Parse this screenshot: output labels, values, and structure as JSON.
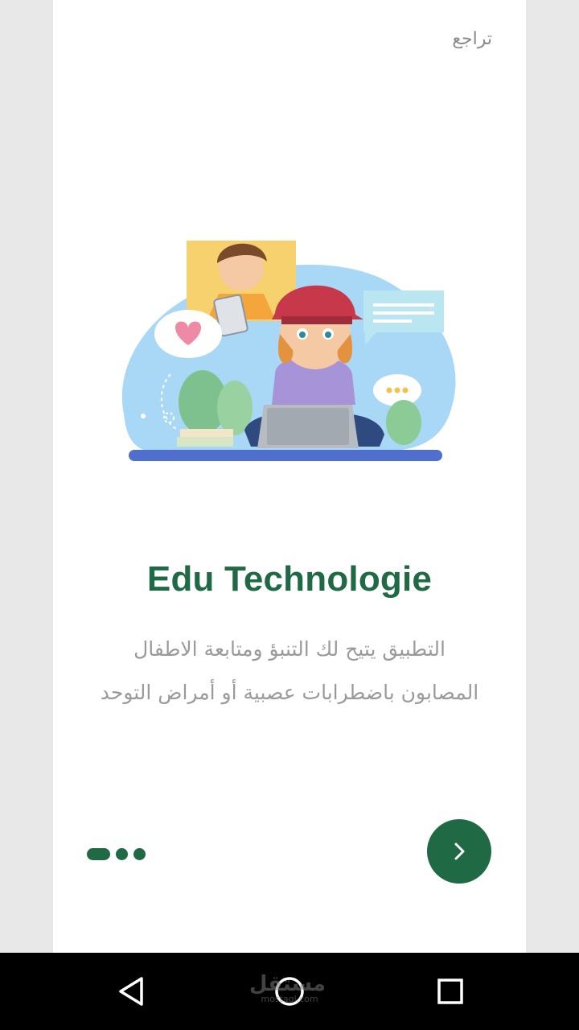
{
  "onboarding": {
    "skip_label": "تراجع",
    "title": "Edu Technologie",
    "description": "التطبيق يتيح لك التنبؤ ومتابعة الاطفال المصابون باضطرابات عصبية أو أمراض التوحد",
    "pager": {
      "total": 3,
      "active_index": 0
    }
  },
  "illustration": {
    "name": "kids-online-learning-illustration"
  },
  "watermark": {
    "main": "مستقل",
    "sub": "mostaql.com"
  },
  "colors": {
    "primary": "#1f6a45",
    "text_muted": "#9a9a9a",
    "background": "#ffffff",
    "side_background": "#e8e8e8",
    "navbar": "#000000"
  },
  "icons": {
    "next": "chevron-right-icon",
    "back": "back-triangle-icon",
    "home": "home-circle-icon",
    "recents": "recents-square-icon"
  }
}
